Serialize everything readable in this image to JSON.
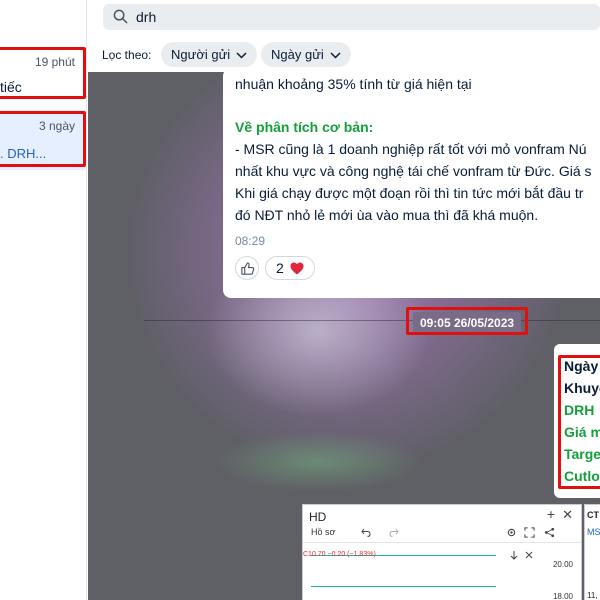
{
  "left_panel": {
    "conversations": [
      {
        "time": "19 phút",
        "preview": "tiếc"
      },
      {
        "time": "3 ngày",
        "preview": ". DRH..."
      }
    ]
  },
  "search": {
    "query": "drh"
  },
  "filter": {
    "label": "Lọc theo:",
    "chips": [
      "Người gửi",
      "Ngày gửi"
    ]
  },
  "message": {
    "lines": [
      "nhuận khoảng 35% tính từ giá hiện tại",
      "Về phân tích cơ bản:",
      "- MSR cũng là 1 doanh nghiệp rất tốt với mỏ vonfram Nú",
      "nhất khu vực và công nghệ tái chế vonfram từ Đức. Giá s",
      "Khi giá chạy được một đoạn rồi thì tin tức mới bắt đầu tr",
      "đó NĐT nhỏ lẻ mới ùa vào mua thì đã khá muộn."
    ],
    "time": "08:29",
    "reaction_count": "2"
  },
  "date_separator": "09:05 26/05/2023",
  "message2": {
    "lines": [
      "Ngày",
      "Khuyế",
      "DRH",
      "Giá m",
      "Targe",
      "Cutlo"
    ]
  },
  "chart_image": {
    "title": "HD",
    "tool": "Hồ sơ",
    "price": "C10.70 −0.20 (−1.83%)",
    "axis_1": "20.00",
    "axis_2": "18.00",
    "side_title": "CT",
    "side_sub": "MS",
    "side_num": "11,"
  },
  "colors": {
    "highlight": "#e01010",
    "green": "#13a03a",
    "link": "#1f62c9"
  }
}
